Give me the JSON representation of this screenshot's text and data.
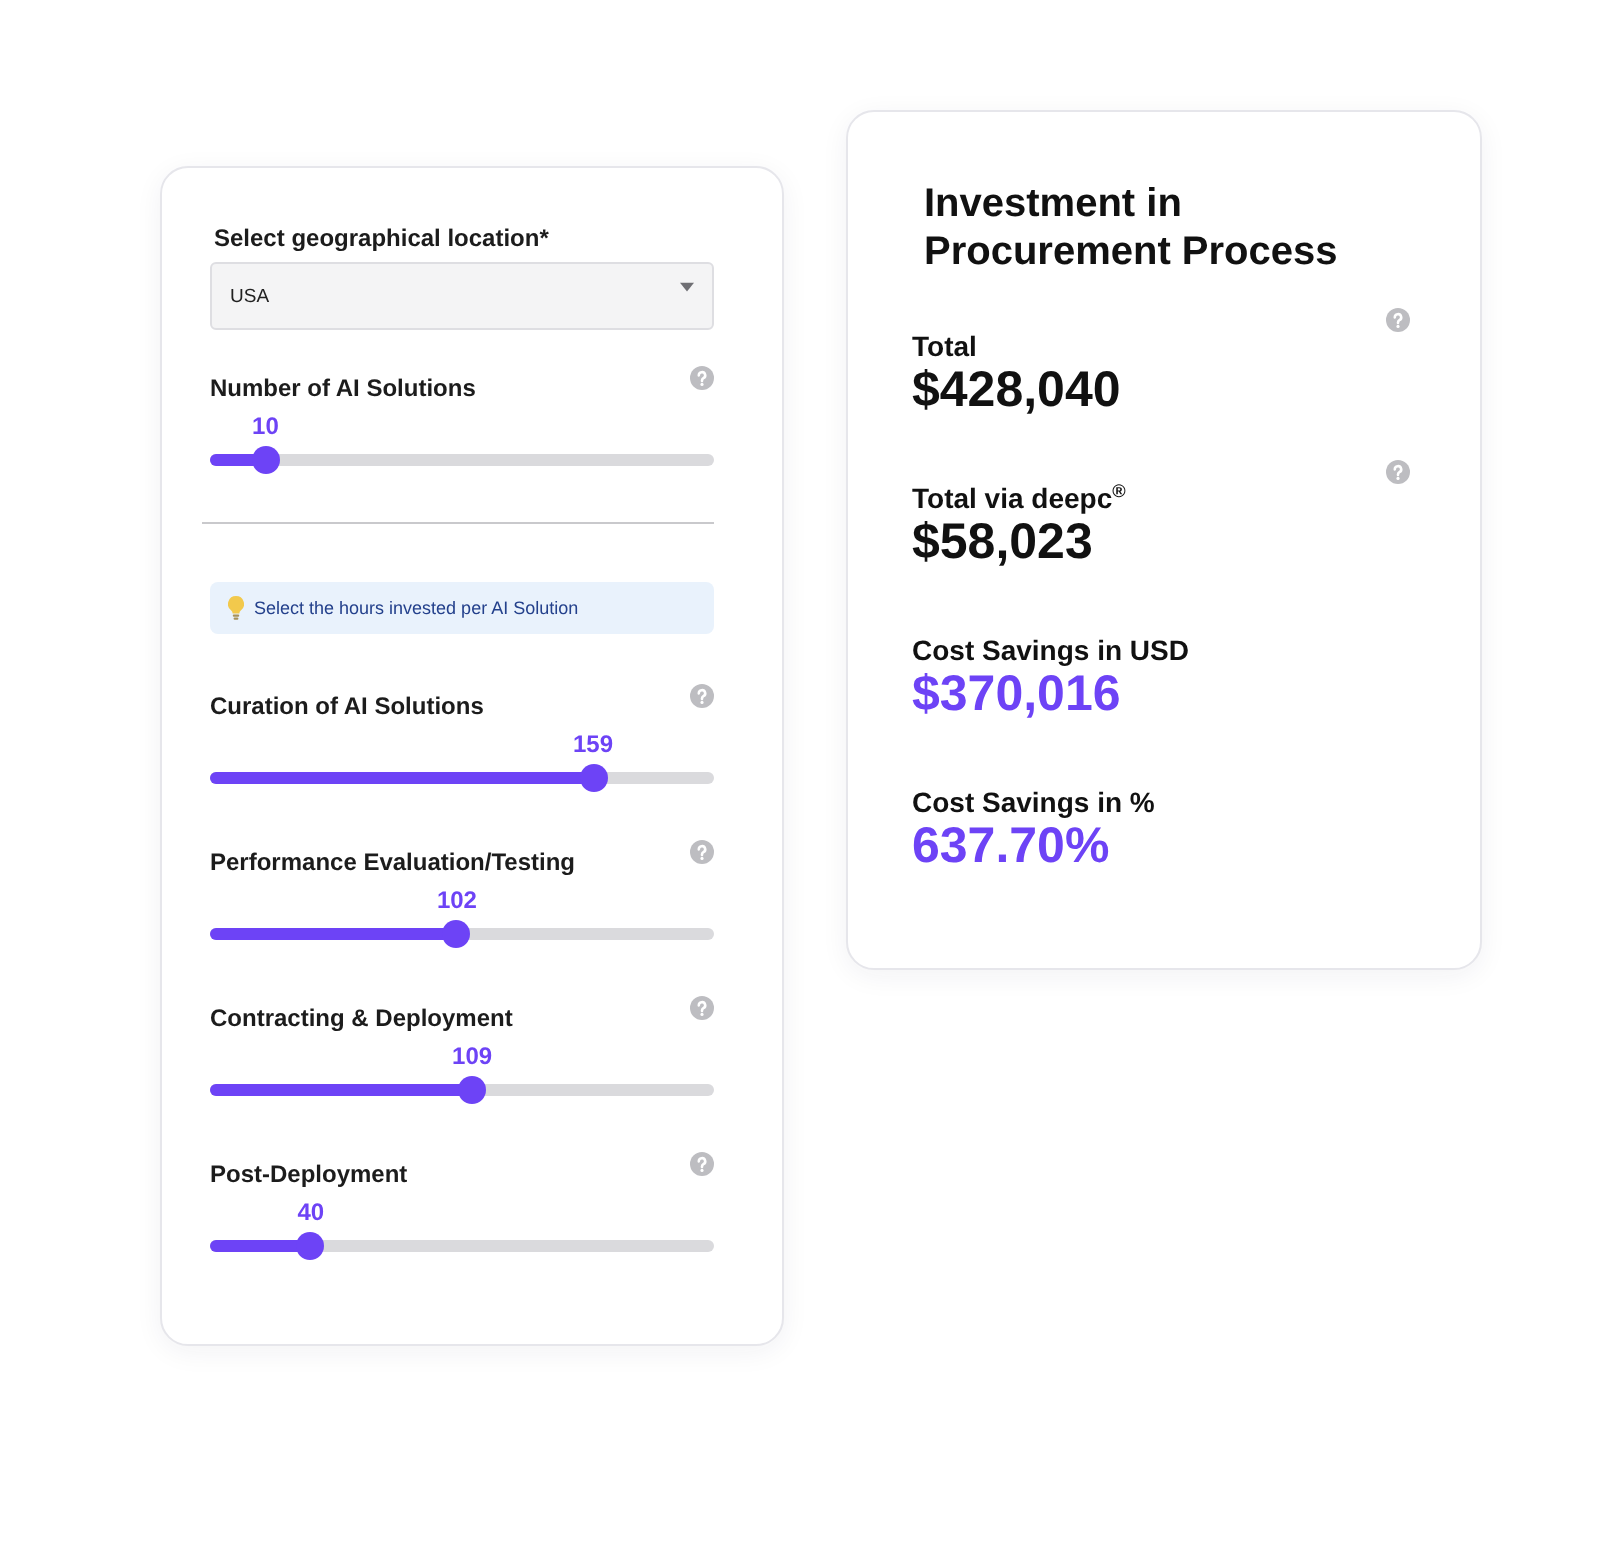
{
  "inputs_card": {
    "location": {
      "label": "Select geographical location*",
      "value": "USA"
    },
    "solutions_slider": {
      "label": "Number of AI Solutions",
      "reading": "10",
      "level": 0.11
    },
    "hint": {
      "text": "Select the hours invested per AI Solution"
    },
    "hour_sliders": [
      {
        "label": "Curation of AI Solutions",
        "reading": "159",
        "level": 0.76
      },
      {
        "label": "Performance Evaluation/Testing",
        "reading": "102",
        "level": 0.49
      },
      {
        "label": "Contracting & Deployment",
        "reading": "109",
        "level": 0.52
      },
      {
        "label": "Post-Deployment",
        "reading": "40",
        "level": 0.2
      }
    ]
  },
  "results_card": {
    "title": "Investment in Procurement Process",
    "metrics": [
      {
        "label": "Total",
        "value": "$428,040",
        "kind": "cost",
        "help": true
      },
      {
        "label": "Total via deepc$^{®}$",
        "value": "$58,023",
        "kind": "cost",
        "help": true
      },
      {
        "label": "Cost Savings in USD",
        "value": "$370,016",
        "kind": "saving",
        "help": false
      },
      {
        "label": "Cost Savings in %",
        "value": "637.70%",
        "kind": "saving",
        "help": false
      }
    ]
  }
}
